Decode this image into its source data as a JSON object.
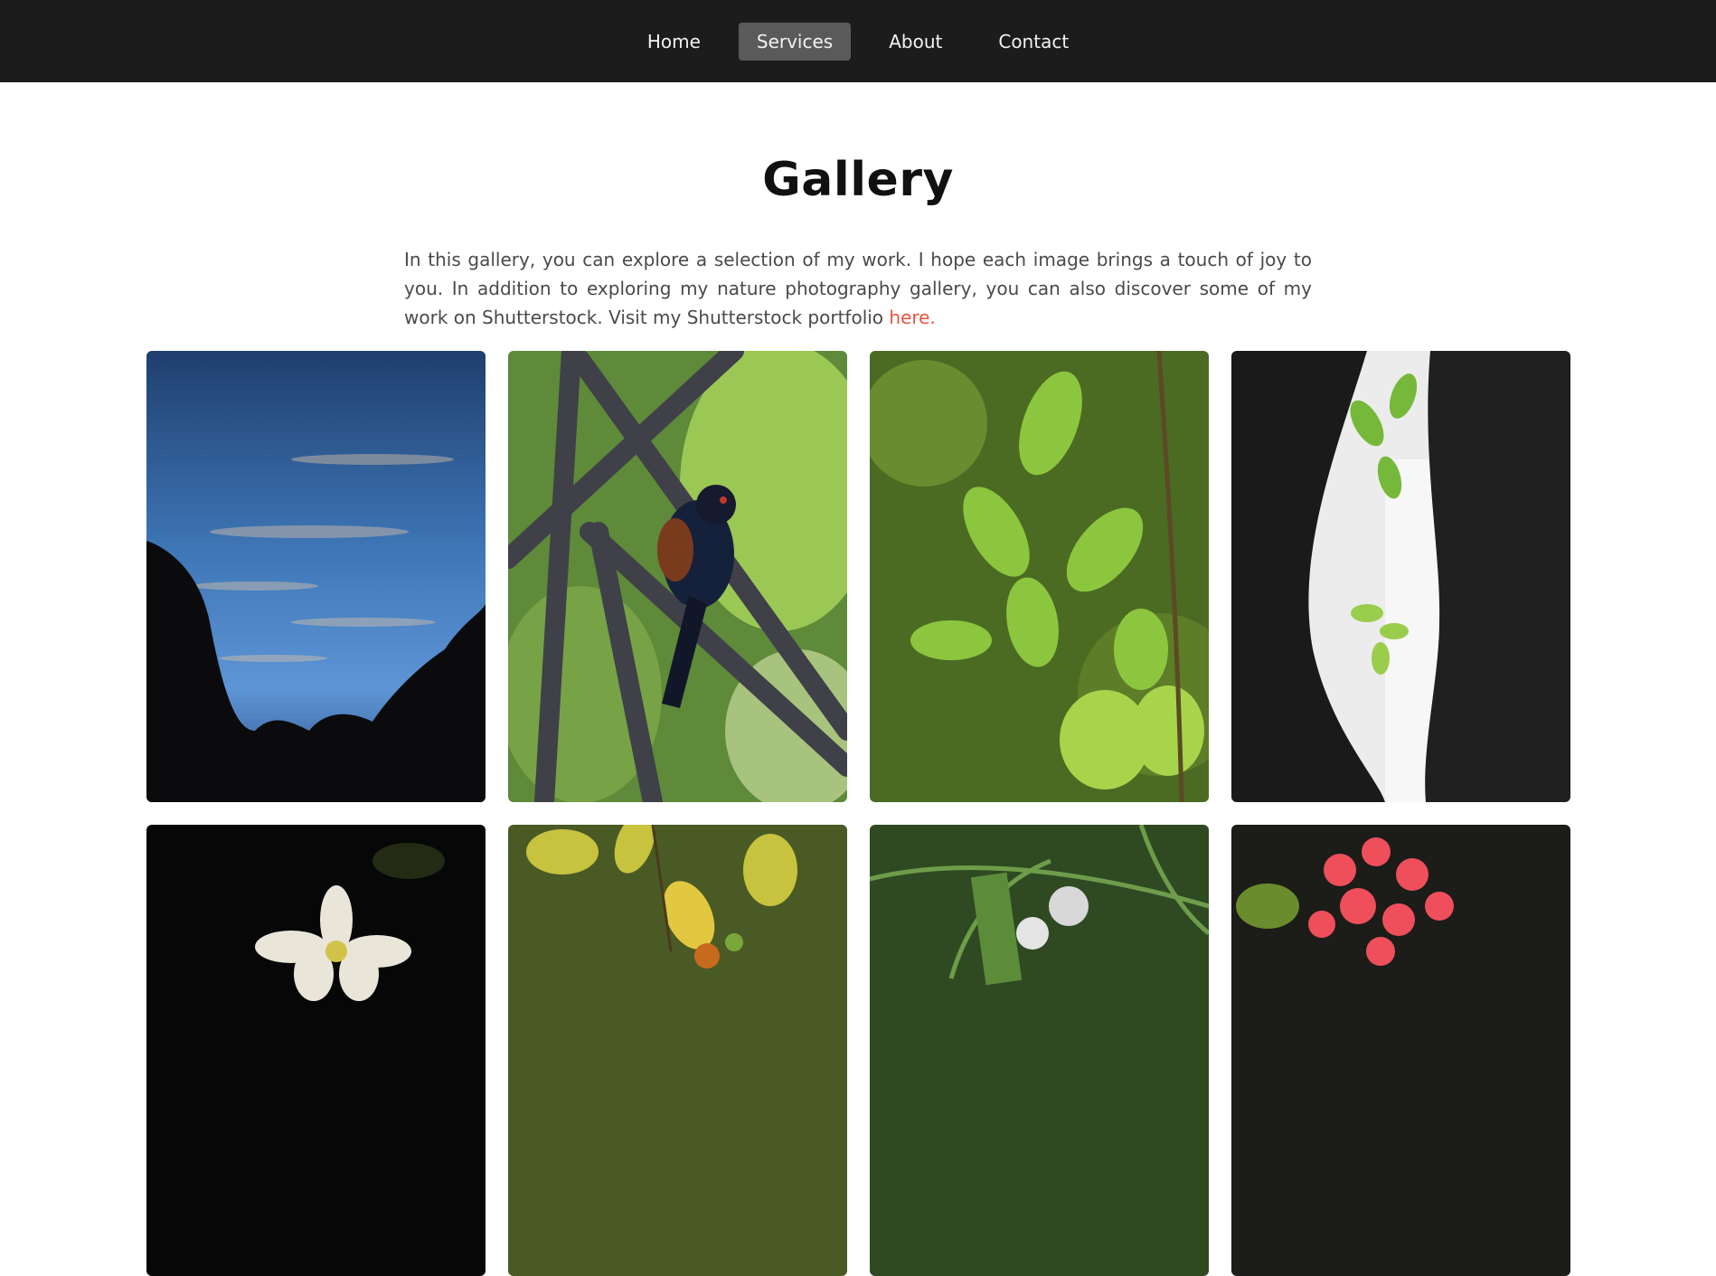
{
  "nav": {
    "items": [
      {
        "label": "Home",
        "active": false
      },
      {
        "label": "Services",
        "active": true
      },
      {
        "label": "About",
        "active": false
      },
      {
        "label": "Contact",
        "active": false
      }
    ]
  },
  "gallery": {
    "title": "Gallery",
    "intro_text": "In this gallery, you can explore a selection of my work. I hope each image brings a touch of joy to you. In addition to exploring my nature photography gallery, you can also discover some of my work on Shutterstock. Visit my Shutterstock portfolio ",
    "link_text": "here.",
    "photos": [
      {
        "subject": "evening-sky-with-tree-silhouettes"
      },
      {
        "subject": "bird-perched-on-metal-frame"
      },
      {
        "subject": "green-leaves"
      },
      {
        "subject": "tree-trunks-with-sapling"
      },
      {
        "subject": "white-flower"
      },
      {
        "subject": "orange-berries-on-branch"
      },
      {
        "subject": "white-puff-flowers-in-grass"
      },
      {
        "subject": "red-flower-cluster"
      }
    ]
  },
  "colors": {
    "nav_bg": "#1c1c1c",
    "nav_active_bg": "#5a5a5a",
    "link": "#e8553e"
  }
}
